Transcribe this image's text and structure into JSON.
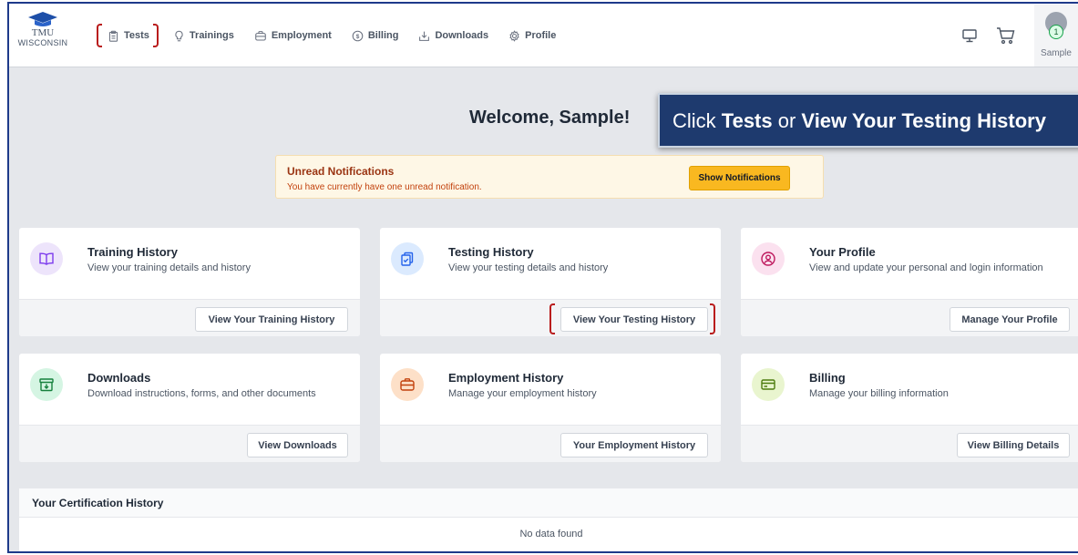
{
  "logo": {
    "line1": "TMU",
    "line2": "WISCONSIN"
  },
  "nav": {
    "tests": "Tests",
    "trainings": "Trainings",
    "employment": "Employment",
    "billing": "Billing",
    "downloads": "Downloads",
    "profile": "Profile"
  },
  "user": {
    "name": "Sample",
    "badge": "1"
  },
  "welcome": "Welcome, Sample!",
  "callout": {
    "pre": "Click ",
    "b1": "Tests",
    "mid": " or ",
    "b2": "View Your Testing History"
  },
  "notification": {
    "title": "Unread Notifications",
    "text": "You have currently have one unread notification.",
    "button": "Show Notifications"
  },
  "cards": {
    "training": {
      "title": "Training History",
      "desc": "View your training details and history",
      "button": "View Your Training History",
      "icon": "book-icon",
      "icon_bg": "#ede4fb",
      "icon_color": "#7c3aed"
    },
    "testing": {
      "title": "Testing History",
      "desc": "View your testing details and history",
      "button": "View Your Testing History",
      "icon": "clipboard-check-icon",
      "icon_bg": "#dbeafe",
      "icon_color": "#2563eb"
    },
    "profile": {
      "title": "Your Profile",
      "desc": "View and update your personal and login information",
      "button": "Manage Your Profile",
      "icon": "user-circle-icon",
      "icon_bg": "#fbe1ef",
      "icon_color": "#be185d"
    },
    "downloads": {
      "title": "Downloads",
      "desc": "Download instructions, forms, and other documents",
      "button": "View Downloads",
      "icon": "archive-icon",
      "icon_bg": "#d5f5e3",
      "icon_color": "#15803d"
    },
    "employment": {
      "title": "Employment History",
      "desc": "Manage your employment history",
      "button": "Your Employment History",
      "icon": "briefcase-icon",
      "icon_bg": "#fde0c8",
      "icon_color": "#c2410c"
    },
    "billing": {
      "title": "Billing",
      "desc": "Manage your billing information",
      "button": "View Billing Details",
      "icon": "credit-card-icon",
      "icon_bg": "#e9f5cf",
      "icon_color": "#4d7c0f"
    }
  },
  "certification": {
    "title": "Your Certification History",
    "empty": "No data found"
  },
  "colors": {
    "callout_bg": "#1e3a6e",
    "notif_button": "#f9b820",
    "highlight": "#b91c1c"
  }
}
